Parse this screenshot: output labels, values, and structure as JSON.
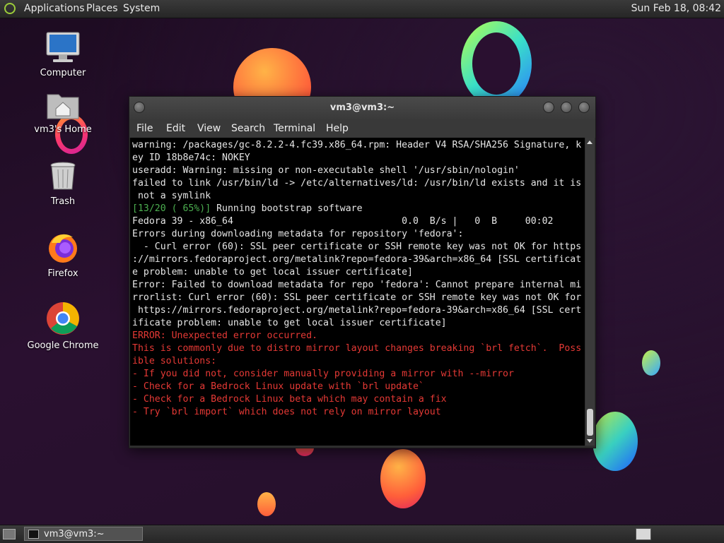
{
  "top_panel": {
    "menus": [
      "Applications",
      "Places",
      "System"
    ],
    "clock": "Sun Feb 18, 08:42"
  },
  "desktop": {
    "icons": [
      {
        "label": "Computer",
        "icon": "computer-icon"
      },
      {
        "label": "vm3's Home",
        "icon": "folder-home-icon"
      },
      {
        "label": "Trash",
        "icon": "trash-icon"
      },
      {
        "label": "Firefox",
        "icon": "firefox-icon"
      },
      {
        "label": "Google Chrome",
        "icon": "chrome-icon"
      }
    ]
  },
  "terminal": {
    "title": "vm3@vm3:~",
    "menu": [
      "File",
      "Edit",
      "View",
      "Search",
      "Terminal",
      "Help"
    ],
    "lines": [
      {
        "text": "warning: /packages/gc-8.2.2-4.fc39.x86_64.rpm: Header V4 RSA/SHA256 Signature, k",
        "color": "default"
      },
      {
        "text": "ey ID 18b8e74c: NOKEY",
        "color": "default"
      },
      {
        "text": "useradd: Warning: missing or non-executable shell '/usr/sbin/nologin'",
        "color": "default"
      },
      {
        "text": "failed to link /usr/bin/ld -> /etc/alternatives/ld: /usr/bin/ld exists and it is",
        "color": "default"
      },
      {
        "text": " not a symlink",
        "color": "default"
      },
      {
        "prefix": "[13/20 ( 65%)]",
        "text": " Running bootstrap software",
        "color": "default"
      },
      {
        "text": "Fedora 39 - x86_64                              0.0  B/s |   0  B     00:02",
        "color": "default"
      },
      {
        "text": "Errors during downloading metadata for repository 'fedora':",
        "color": "default"
      },
      {
        "text": "  - Curl error (60): SSL peer certificate or SSH remote key was not OK for https",
        "color": "default"
      },
      {
        "text": "://mirrors.fedoraproject.org/metalink?repo=fedora-39&arch=x86_64 [SSL certificat",
        "color": "default"
      },
      {
        "text": "e problem: unable to get local issuer certificate]",
        "color": "default"
      },
      {
        "text": "Error: Failed to download metadata for repo 'fedora': Cannot prepare internal mi",
        "color": "default"
      },
      {
        "text": "rrorlist: Curl error (60): SSL peer certificate or SSH remote key was not OK for",
        "color": "default"
      },
      {
        "text": " https://mirrors.fedoraproject.org/metalink?repo=fedora-39&arch=x86_64 [SSL cert",
        "color": "default"
      },
      {
        "text": "ificate problem: unable to get local issuer certificate]",
        "color": "default"
      },
      {
        "text": "ERROR: Unexpected error occurred.",
        "color": "red"
      },
      {
        "text": "This is commonly due to distro mirror layout changes breaking `brl fetch`.  Poss",
        "color": "red"
      },
      {
        "text": "ible solutions:",
        "color": "red"
      },
      {
        "text": "- If you did not, consider manually providing a mirror with --mirror",
        "color": "red"
      },
      {
        "text": "- Check for a Bedrock Linux update with `brl update`",
        "color": "red"
      },
      {
        "text": "- Check for a Bedrock Linux beta which may contain a fix",
        "color": "red"
      },
      {
        "text": "- Try `brl import` which does not rely on mirror layout",
        "color": "red"
      }
    ]
  },
  "taskbar": {
    "items": [
      {
        "label": "vm3@vm3:~"
      }
    ]
  },
  "colors": {
    "prompt_green": "#4caf50",
    "error_red": "#e53935",
    "terminal_bg": "#000000"
  }
}
